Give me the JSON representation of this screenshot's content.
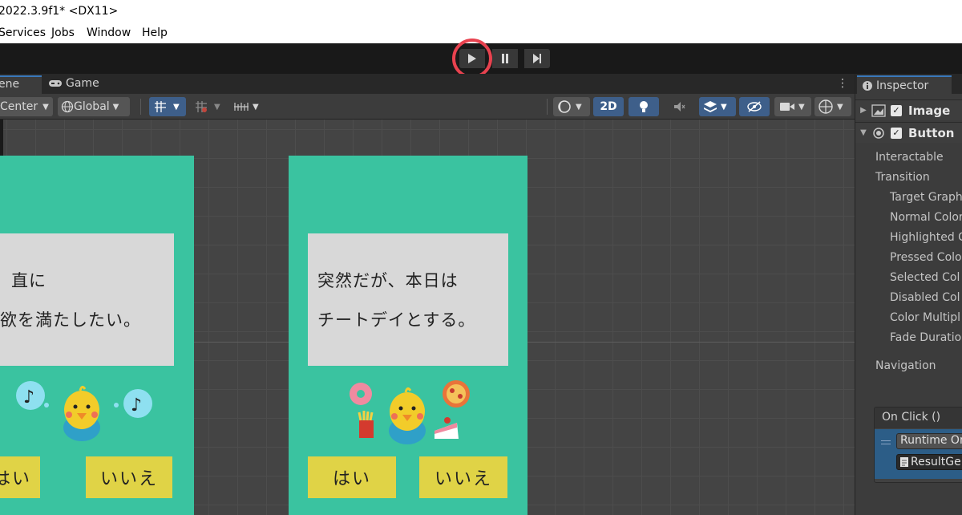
{
  "window": {
    "title": "2022.3.9f1* <DX11>"
  },
  "menu": {
    "items": [
      "Services",
      "Jobs",
      "Window",
      "Help"
    ]
  },
  "tabs": {
    "scene": "ene",
    "game": "Game"
  },
  "scene_toolbar": {
    "pivot": "Center",
    "space": "Global",
    "mode_2d": "2D"
  },
  "game_screens": {
    "left": {
      "line1": "直に",
      "line2": "欲を満たしたい。",
      "yes": "はい",
      "no": "いいえ"
    },
    "right": {
      "line1": "突然だが、本日は",
      "line2": "チートデイとする。",
      "yes": "はい",
      "no": "いいえ"
    }
  },
  "inspector": {
    "tab": "Inspector",
    "components": [
      "Image",
      "Button"
    ],
    "properties": [
      "Interactable",
      "Transition",
      "Target Graph",
      "Normal Color",
      "Highlighted C",
      "Pressed Colo",
      "Selected Col",
      "Disabled Col",
      "Color Multipl",
      "Fade Duratio",
      "Navigation"
    ],
    "on_click": {
      "header": "On Click ()",
      "runtime": "Runtime On",
      "object": "ResultGe"
    }
  },
  "colors": {
    "highlight_ring": "#e8424f",
    "scene_bg": "#3ac3a0",
    "button_yellow": "#e0d346",
    "accent_blue": "#3a79bb"
  }
}
